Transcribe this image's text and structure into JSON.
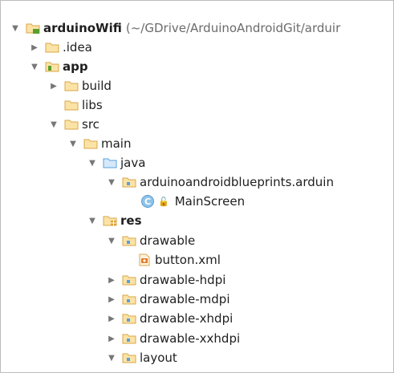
{
  "colors": {
    "folder": "#d9a74a",
    "folder_blue": "#5aa0dc",
    "package_dot": "#5aa0dc",
    "module_badge": "#5aa02c",
    "res_badge": "#e0a030",
    "xml_badge": "#e07a2a"
  },
  "tree": {
    "root": {
      "name": "arduinoWifi",
      "path": "(~/GDrive/ArduinoAndroidGit/arduir",
      "icon": "module-folder-icon",
      "expanded": true
    },
    "idea": {
      "name": ".idea",
      "icon": "folder-icon",
      "expanded": false
    },
    "app": {
      "name": "app",
      "icon": "module-folder-icon",
      "expanded": true
    },
    "build": {
      "name": "build",
      "icon": "folder-icon",
      "expanded": false
    },
    "libs": {
      "name": "libs",
      "icon": "folder-icon"
    },
    "src": {
      "name": "src",
      "icon": "folder-icon",
      "expanded": true
    },
    "main": {
      "name": "main",
      "icon": "folder-icon",
      "expanded": true
    },
    "java": {
      "name": "java",
      "icon": "source-folder-icon",
      "expanded": true
    },
    "package": {
      "name": "arduinoandroidblueprints.arduin",
      "icon": "package-icon",
      "expanded": true
    },
    "mainscreen": {
      "name": "MainScreen",
      "icon": "class-icon",
      "badge": "C"
    },
    "res": {
      "name": "res",
      "icon": "resource-folder-icon",
      "expanded": true
    },
    "drawable": {
      "name": "drawable",
      "icon": "package-icon",
      "expanded": true
    },
    "button_xml": {
      "name": "button.xml",
      "icon": "xml-file-icon"
    },
    "drawable_hdpi": {
      "name": "drawable-hdpi",
      "icon": "package-icon",
      "expanded": false
    },
    "drawable_mdpi": {
      "name": "drawable-mdpi",
      "icon": "package-icon",
      "expanded": false
    },
    "drawable_xhdpi": {
      "name": "drawable-xhdpi",
      "icon": "package-icon",
      "expanded": false
    },
    "drawable_xxhdpi": {
      "name": "drawable-xxhdpi",
      "icon": "package-icon",
      "expanded": false
    },
    "layout": {
      "name": "layout",
      "icon": "package-icon",
      "expanded": true
    }
  }
}
